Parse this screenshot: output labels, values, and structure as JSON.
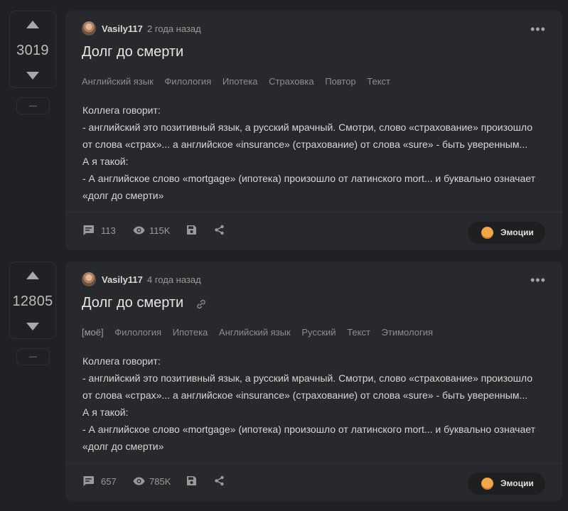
{
  "posts": [
    {
      "rating": "3019",
      "minus_label": "—",
      "author": "Vasily117",
      "time": "2 года назад",
      "title": "Долг до смерти",
      "tags": [
        "Английский язык",
        "Филология",
        "Ипотека",
        "Страховка",
        "Повтор",
        "Текст"
      ],
      "body": [
        "Коллега говорит:",
        "- английский это позитивный язык, а русский мрачный. Смотри, слово «страхование» произошло",
        "от слова «страх»... а английское «insurance» (страхование) от слова «sure» - быть уверенным...",
        "А я такой:",
        "- А английское слово «mortgage» (ипотека) произошло от латинского mort... и буквально означает",
        "«долг до смерти»"
      ],
      "comments": "113",
      "views": "115K",
      "emotions_label": "Эмоции"
    },
    {
      "rating": "12805",
      "minus_label": "—",
      "author": "Vasily117",
      "time": "4 года назад",
      "title": "Долг до смерти",
      "mine_label": "[моё]",
      "tags": [
        "Филология",
        "Ипотека",
        "Английский язык",
        "Русский",
        "Текст",
        "Этимология"
      ],
      "body": [
        "Коллега говорит:",
        "- английский это позитивный язык, а русский мрачный. Смотри, слово «страхование» произошло",
        "от слова «страх»... а английское «insurance» (страхование) от слова «sure» - быть уверенным...",
        "А я такой:",
        "- А английское слово «mortgage» (ипотека) произошло от латинского mort... и буквально означает",
        "«долг до смерти»"
      ],
      "comments": "657",
      "views": "785K",
      "emotions_label": "Эмоции"
    }
  ],
  "more_label": "•••",
  "icons": {
    "vote_up": "arrow-up-icon",
    "vote_down": "arrow-down-icon",
    "comments": "comment-icon",
    "views": "eye-icon",
    "save": "save-icon",
    "share": "share-icon",
    "link": "link-icon",
    "emotions": "emoji-icon"
  },
  "colors": {
    "background": "#202124",
    "card": "#28292c",
    "accent_emoji": "#f2a64b"
  }
}
